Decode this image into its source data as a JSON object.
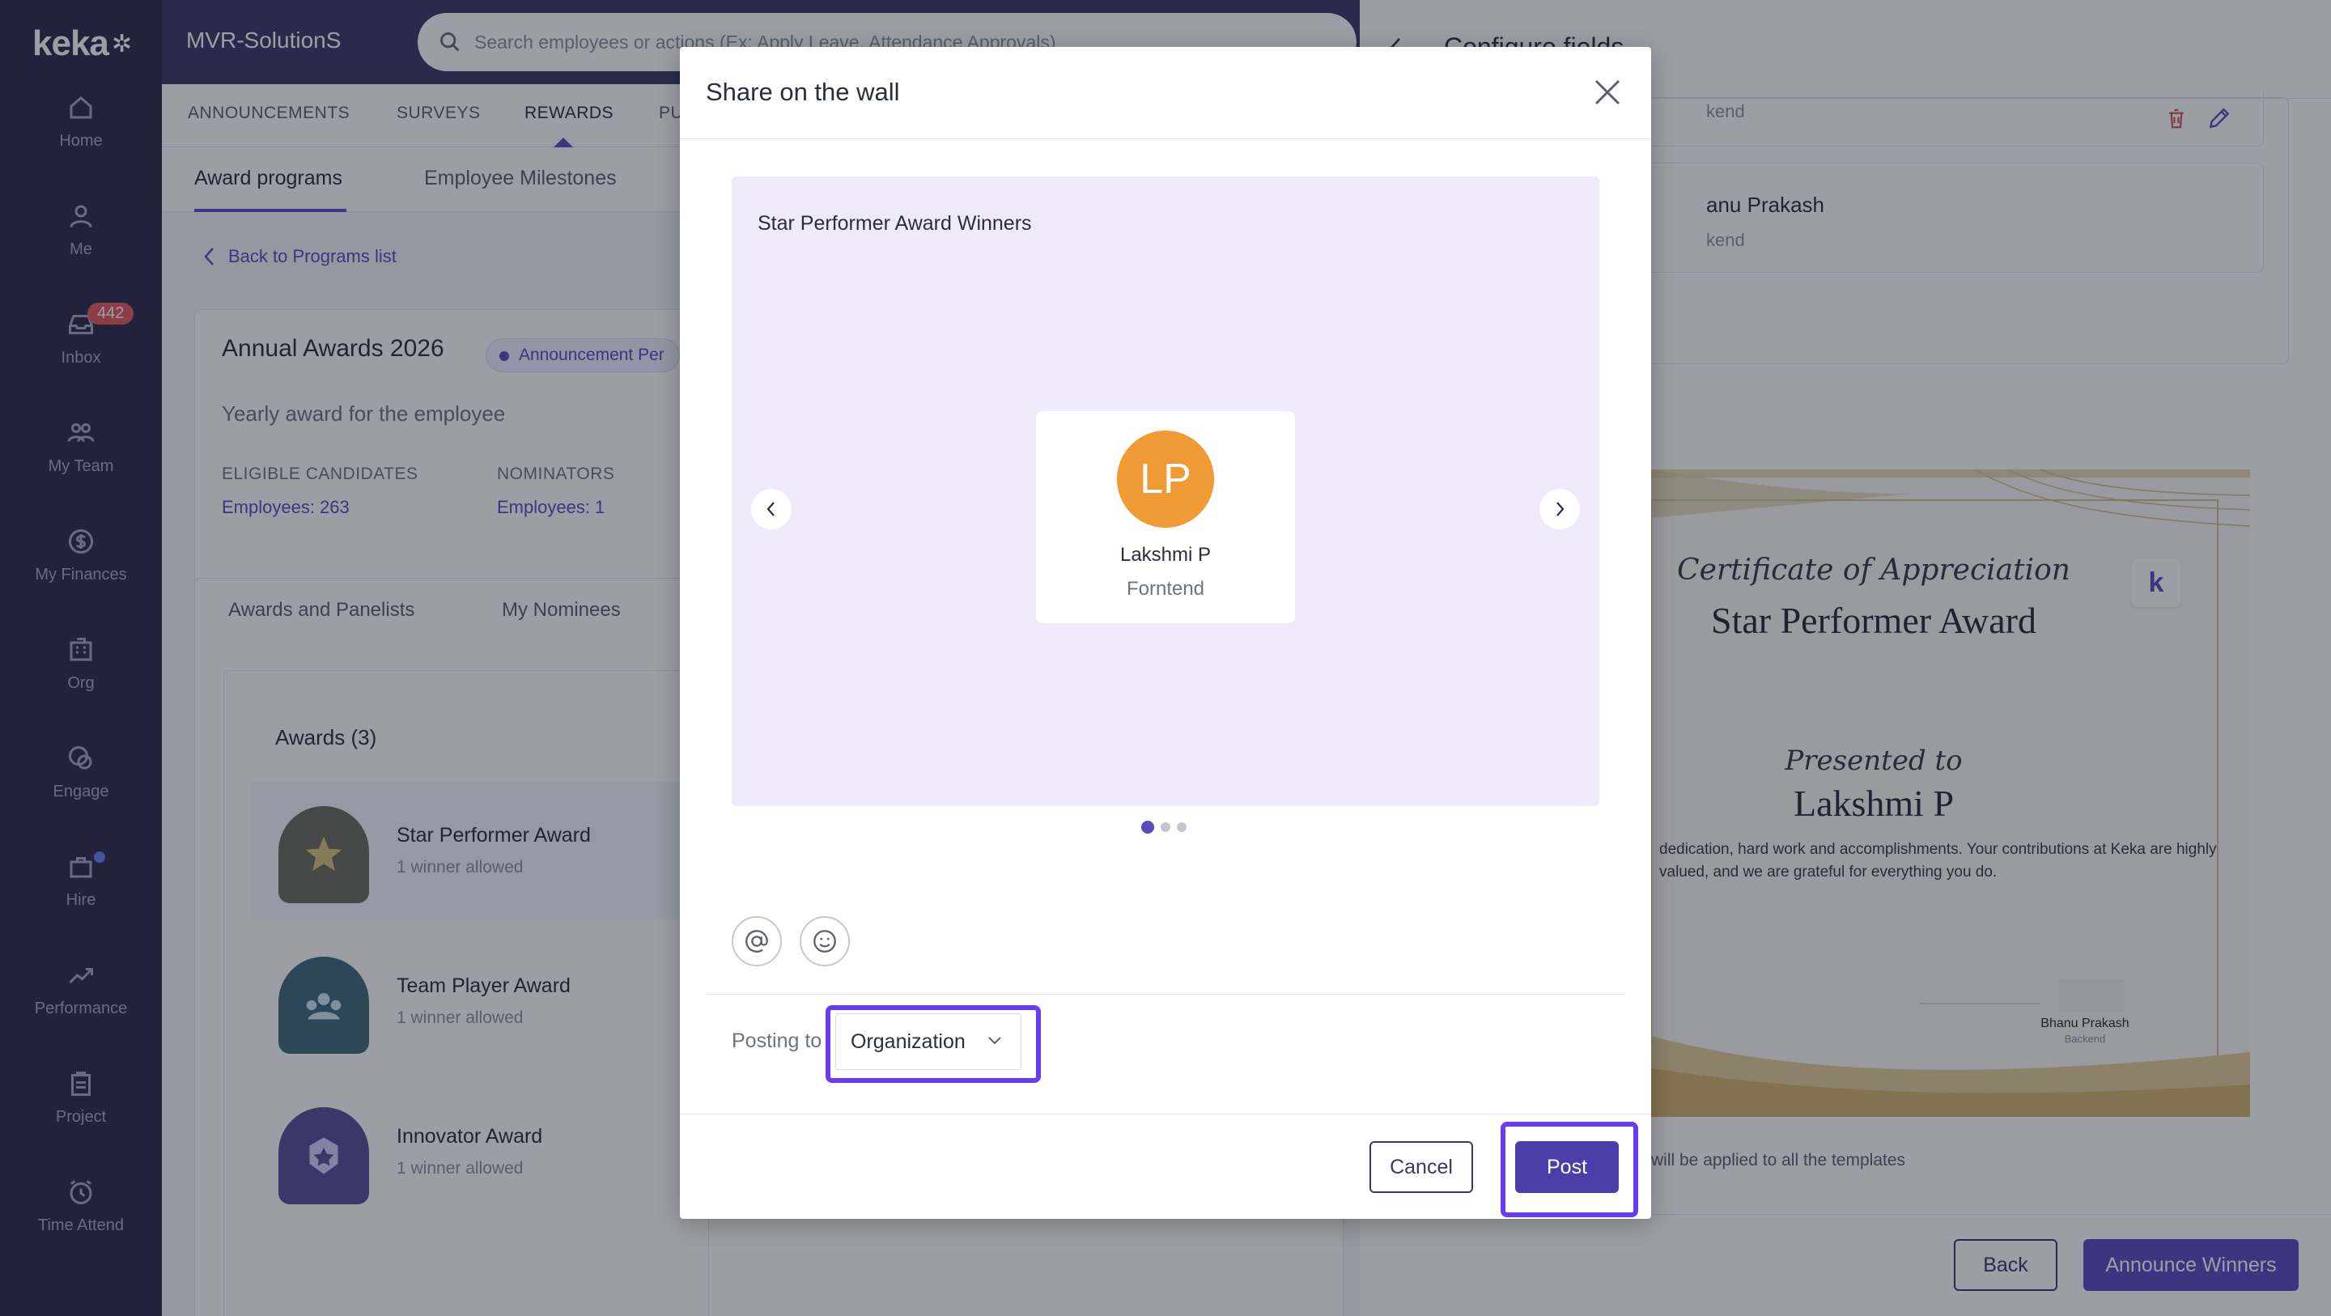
{
  "app": {
    "logo": "keka",
    "org_name": "MVR-SolutionS",
    "search_placeholder": "Search employees or actions (Ex: Apply Leave, Attendance Approvals)"
  },
  "sidebar": {
    "items": [
      {
        "label": "Home",
        "icon": "home-icon"
      },
      {
        "label": "Me",
        "icon": "user-icon"
      },
      {
        "label": "Inbox",
        "icon": "inbox-icon",
        "badge": "442"
      },
      {
        "label": "My Team",
        "icon": "team-icon"
      },
      {
        "label": "My Finances",
        "icon": "dollar-icon"
      },
      {
        "label": "Org",
        "icon": "building-icon"
      },
      {
        "label": "Engage",
        "icon": "engage-icon"
      },
      {
        "label": "Hire",
        "icon": "briefcase-icon"
      },
      {
        "label": "Performance",
        "icon": "trend-icon"
      },
      {
        "label": "Project",
        "icon": "clipboard-icon"
      },
      {
        "label": "Time Attend",
        "icon": "alarm-icon"
      }
    ]
  },
  "main": {
    "tabs": [
      "ANNOUNCEMENTS",
      "SURVEYS",
      "REWARDS",
      "PU"
    ],
    "subtabs": [
      "Award programs",
      "Employee Milestones"
    ],
    "back_label": "Back to Programs list",
    "program": {
      "title": "Annual Awards 2026",
      "badge": "Announcement Per",
      "description": "Yearly award for the employee",
      "eligible_label": "ELIGIBLE CANDIDATES",
      "eligible_value": "Employees: 263",
      "nominators_label": "NOMINATORS",
      "nominators_value": "Employees: 1"
    },
    "section_tabs": [
      "Awards and Panelists",
      "My Nominees"
    ],
    "awards_heading": "Awards (3)",
    "awards": [
      {
        "name": "Star Performer Award",
        "sub": "1 winner allowed",
        "color": "#6b6a5e"
      },
      {
        "name": "Team Player Award",
        "sub": "1 winner allowed",
        "color": "#3f6a7a"
      },
      {
        "name": "Innovator Award",
        "sub": "1 winner allowed",
        "color": "#5a4f9a"
      }
    ]
  },
  "right_panel": {
    "title": "Configure fields",
    "row_top_dept": "kend",
    "row_name": "anu Prakash",
    "row_dept": "kend",
    "certificate": {
      "heading_script": "Certificate of Appreciation",
      "award_title": "Star Performer Award",
      "presented_script": "Presented to",
      "recipient": "Lakshmi P",
      "body": "dedication, hard work and accomplishments. Your contributions at Keka are highly valued, and we are grateful for everything you do.",
      "signer_name": "Bhanu Prakash",
      "signer_role": "Backend"
    },
    "note": "will be applied to all the templates",
    "back_label": "Back",
    "announce_label": "Announce Winners"
  },
  "modal": {
    "title": "Share on the wall",
    "slide_title": "Star Performer Award Winners",
    "winner": {
      "initials": "LP",
      "name": "Lakshmi P",
      "dept": "Forntend",
      "avatar_color": "#f09a35"
    },
    "carousel": {
      "current": 1,
      "total": 3
    },
    "posting_label": "Posting to",
    "posting_value": "Organization",
    "cancel_label": "Cancel",
    "post_label": "Post"
  },
  "colors": {
    "brand": "#5a4bbd",
    "sidebar": "#2d2a4c",
    "highlight": "#6a3cf0",
    "slide_bg": "#efe9fc"
  }
}
